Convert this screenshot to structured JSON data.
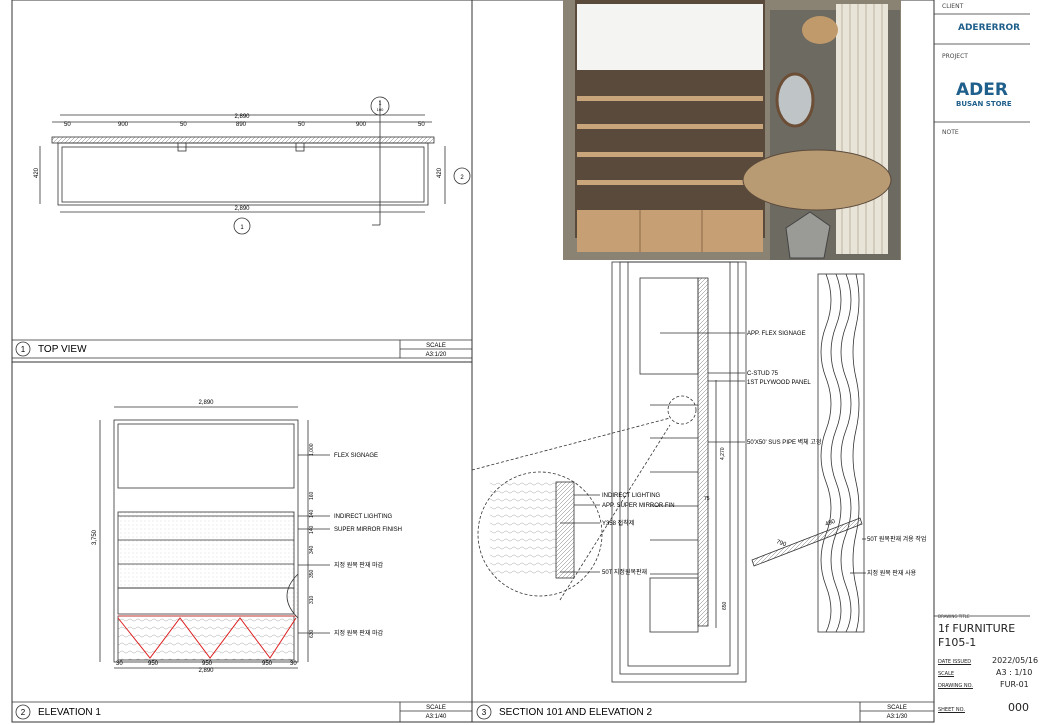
{
  "title_block": {
    "client_label": "CLIENT",
    "client_name": "ADERERROR",
    "project_label": "PROJECT",
    "project_name": "ADER",
    "project_sub": "BUSAN STORE",
    "note_label": "NOTE",
    "drawing_title_label": "DRAWING TITLE",
    "drawing_title_line1": "1f FURNITURE",
    "drawing_title_line2": "F105-1",
    "date_label": "DATE ISSUED",
    "date_value": "2022/05/16",
    "scale_label": "SCALE",
    "scale_value": "A3 : 1/10",
    "drawing_no_label": "DRAWING NO.",
    "drawing_no_value": "FUR-01",
    "sheet_label": "SHEET NO.",
    "sheet_value": "000",
    "brand_color": "#1f5f8b"
  },
  "panels": [
    {
      "num": "1",
      "title": "TOP VIEW",
      "scale_label": "SCALE",
      "scale_value": "A3:1/20"
    },
    {
      "num": "2",
      "title": "ELEVATION 1",
      "scale_label": "SCALE",
      "scale_value": "A3:1/40"
    },
    {
      "num": "3",
      "title": "SECTION 101 AND ELEVATION 2",
      "scale_label": "SCALE",
      "scale_value": "A3:1/30"
    }
  ],
  "top_view": {
    "overall": "2,890",
    "segments": [
      "50",
      "900",
      "50",
      "890",
      "50",
      "900",
      "50"
    ],
    "depth_left": "420",
    "depth_right": "420",
    "bottom": "2,890",
    "marker_bottom": "1",
    "marker_top_num": "1",
    "marker_top_ref": "100",
    "marker_right": "2"
  },
  "elevation1": {
    "overall_top": "2,890",
    "height": "3,750",
    "right_dims": [
      "1,000",
      "160",
      "140",
      "140",
      "340",
      "350",
      "310",
      "630"
    ],
    "bottom_segments": [
      "30",
      "950",
      "950",
      "950",
      "30"
    ],
    "overall_bottom": "2,890",
    "labels": [
      "FLEX SIGNAGE",
      "INDIRECT LIGHTING",
      "SUPER MIRROR FINISH",
      "지정 원목 판재 마감",
      "지정 원목 판재 마감"
    ]
  },
  "section": {
    "labels": [
      "APP. FLEX SIGNAGE",
      "C-STUD 75",
      "1ST PLYWOOD PANEL",
      "50'X50' SUS PIPE 벽체 고정"
    ],
    "dims": [
      "4,270",
      "650",
      "75"
    ],
    "detail_labels": [
      "INDIRECT LIGHTING",
      "APP. SUPER MIRROR FIN",
      "Y358 접착제",
      "50T 지정원목판재"
    ],
    "elev2_labels": [
      "50T 원목판재 겨용 작업",
      "지정 원목 판재 사용"
    ],
    "elev2_dims": [
      "790",
      "490"
    ]
  }
}
